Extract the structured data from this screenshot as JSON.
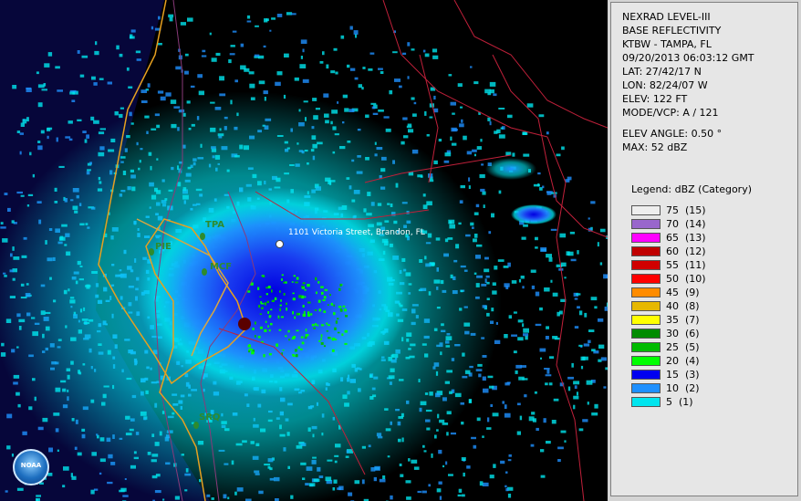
{
  "info": {
    "lines": [
      "NEXRAD LEVEL-III",
      "BASE REFLECTIVITY",
      "KTBW - TAMPA, FL",
      "09/20/2013 06:03:12 GMT",
      "LAT: 27/42/17 N",
      "LON: 82/24/07 W",
      "ELEV: 122 FT",
      "MODE/VCP: A / 121"
    ],
    "elev_angle": "ELEV ANGLE: 0.50 °",
    "max": "MAX: 52 dBZ"
  },
  "legend": {
    "title": "Legend: dBZ (Category)",
    "items": [
      {
        "label": "75  (15)",
        "color": "#eeeeee"
      },
      {
        "label": "70  (14)",
        "color": "#9966cc"
      },
      {
        "label": "65  (13)",
        "color": "#ff00ff"
      },
      {
        "label": "60  (12)",
        "color": "#c00000"
      },
      {
        "label": "55  (11)",
        "color": "#d00000"
      },
      {
        "label": "50  (10)",
        "color": "#ff0000"
      },
      {
        "label": "45  (9)",
        "color": "#ff8c00"
      },
      {
        "label": "40  (8)",
        "color": "#e6b800"
      },
      {
        "label": "35  (7)",
        "color": "#ffff00"
      },
      {
        "label": "30  (6)",
        "color": "#008c00"
      },
      {
        "label": "25  (5)",
        "color": "#00bb00"
      },
      {
        "label": "20  (4)",
        "color": "#00ff00"
      },
      {
        "label": "15  (3)",
        "color": "#0000f0"
      },
      {
        "label": "10  (2)",
        "color": "#1e90ff"
      },
      {
        "label": "5  (1)",
        "color": "#00e5ee"
      }
    ]
  },
  "map": {
    "address": "1101 Victoria Street, Brandon, FL",
    "cities": [
      "TPA",
      "PIE",
      "MCF",
      "SRQ"
    ],
    "logo": "NOAA"
  }
}
